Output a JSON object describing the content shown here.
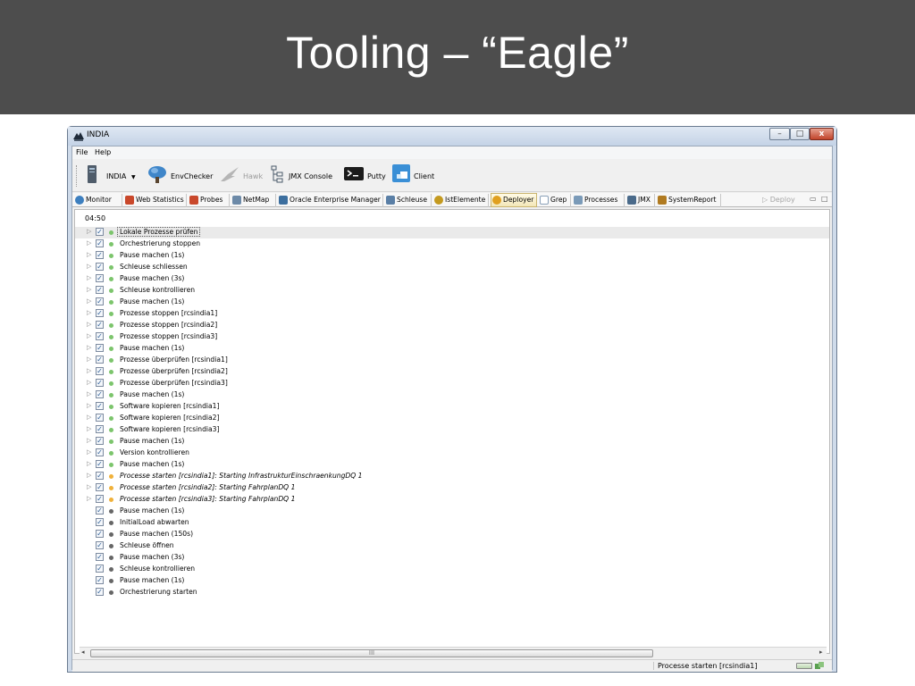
{
  "slide": {
    "title": "Tooling – “Eagle”"
  },
  "window": {
    "title": "INDIA",
    "controls": {
      "minimize": "–",
      "maximize": "□",
      "close": "x"
    }
  },
  "menu": {
    "file": "File",
    "help": "Help"
  },
  "toolbar": {
    "environment": "INDIA",
    "env_dropdown_icon": "▼",
    "envchecker": "EnvChecker",
    "hawk": "Hawk",
    "jmx_console": "JMX Console",
    "putty": "Putty",
    "client": "Client"
  },
  "tabs": [
    {
      "label": "Monitor",
      "icon": "globe-icon",
      "color": "#3d7fbf"
    },
    {
      "label": "Web Statistics",
      "icon": "chart-icon",
      "color": "#c9482b"
    },
    {
      "label": "Probes",
      "icon": "probe-icon",
      "color": "#c9482b"
    },
    {
      "label": "NetMap",
      "icon": "netmap-icon",
      "color": "#6d8aa8"
    },
    {
      "label": "Oracle Enterprise Manager",
      "icon": "oracle-icon",
      "color": "#3c6e9e"
    },
    {
      "label": "Schleuse",
      "icon": "lock-icon",
      "color": "#5a7fa6"
    },
    {
      "label": "IstElemente",
      "icon": "clock-icon",
      "color": "#c49a20"
    },
    {
      "label": "Deployer",
      "icon": "gear-icon",
      "color": "#e0a020"
    },
    {
      "label": "Grep",
      "icon": "document-icon",
      "color": "#8aa0b8"
    },
    {
      "label": "Processes",
      "icon": "process-icon",
      "color": "#7a9ab8"
    },
    {
      "label": "JMX",
      "icon": "server-icon",
      "color": "#4a6a8a"
    },
    {
      "label": "SystemReport",
      "icon": "report-icon",
      "color": "#b07a20"
    }
  ],
  "active_tab": "Deployer",
  "deploy_action": "▷ Deploy",
  "view_controls": {
    "minimize": "▭",
    "maximize": "□"
  },
  "elapsed_time": "04:50",
  "colors": {
    "dot_done": "#7cc56c",
    "dot_running": "#f0b13a",
    "dot_pending": "#666666"
  },
  "rows": [
    {
      "text": "Lokale Prozesse prüfen",
      "expandable": true,
      "checked": "✓",
      "state": "done",
      "italic": false,
      "selected": true
    },
    {
      "text": "Orchestrierung stoppen",
      "expandable": true,
      "checked": "✓",
      "state": "done",
      "italic": false
    },
    {
      "text": "Pause machen (1s)",
      "expandable": true,
      "checked": "✓",
      "state": "done",
      "italic": false
    },
    {
      "text": "Schleuse schliessen",
      "expandable": true,
      "checked": "✓",
      "state": "done",
      "italic": false
    },
    {
      "text": "Pause machen (3s)",
      "expandable": true,
      "checked": "✓",
      "state": "done",
      "italic": false
    },
    {
      "text": "Schleuse kontrollieren",
      "expandable": true,
      "checked": "✓",
      "state": "done",
      "italic": false
    },
    {
      "text": "Pause machen (1s)",
      "expandable": true,
      "checked": "✓",
      "state": "done",
      "italic": false
    },
    {
      "text": "Prozesse stoppen [rcsindia1]",
      "expandable": true,
      "checked": "✓",
      "state": "done",
      "italic": false
    },
    {
      "text": "Prozesse stoppen [rcsindia2]",
      "expandable": true,
      "checked": "✓",
      "state": "done",
      "italic": false
    },
    {
      "text": "Prozesse stoppen [rcsindia3]",
      "expandable": true,
      "checked": "✓",
      "state": "done",
      "italic": false
    },
    {
      "text": "Pause machen (1s)",
      "expandable": true,
      "checked": "✓",
      "state": "done",
      "italic": false
    },
    {
      "text": "Prozesse überprüfen [rcsindia1]",
      "expandable": true,
      "checked": "✓",
      "state": "done",
      "italic": false
    },
    {
      "text": "Prozesse überprüfen [rcsindia2]",
      "expandable": true,
      "checked": "✓",
      "state": "done",
      "italic": false
    },
    {
      "text": "Prozesse überprüfen [rcsindia3]",
      "expandable": true,
      "checked": "✓",
      "state": "done",
      "italic": false
    },
    {
      "text": "Pause machen (1s)",
      "expandable": true,
      "checked": "✓",
      "state": "done",
      "italic": false
    },
    {
      "text": "Software kopieren [rcsindia1]",
      "expandable": true,
      "checked": "✓",
      "state": "done",
      "italic": false
    },
    {
      "text": "Software kopieren [rcsindia2]",
      "expandable": true,
      "checked": "✓",
      "state": "done",
      "italic": false
    },
    {
      "text": "Software kopieren [rcsindia3]",
      "expandable": true,
      "checked": "✓",
      "state": "done",
      "italic": false
    },
    {
      "text": "Pause machen (1s)",
      "expandable": true,
      "checked": "✓",
      "state": "done",
      "italic": false
    },
    {
      "text": "Version kontrollieren",
      "expandable": true,
      "checked": "✓",
      "state": "done",
      "italic": false
    },
    {
      "text": "Pause machen (1s)",
      "expandable": true,
      "checked": "✓",
      "state": "done",
      "italic": false
    },
    {
      "text": "Processe starten [rcsindia1]: Starting InfrastrukturEinschraenkungDQ 1",
      "expandable": true,
      "checked": "✓",
      "state": "running",
      "italic": true
    },
    {
      "text": "Processe starten [rcsindia2]: Starting FahrplanDQ 1",
      "expandable": true,
      "checked": "✓",
      "state": "running",
      "italic": true
    },
    {
      "text": "Processe starten [rcsindia3]: Starting FahrplanDQ 1",
      "expandable": true,
      "checked": "✓",
      "state": "running",
      "italic": true
    },
    {
      "text": "Pause machen (1s)",
      "expandable": false,
      "checked": "✓",
      "state": "pending",
      "italic": false
    },
    {
      "text": "InitialLoad abwarten",
      "expandable": false,
      "checked": "✓",
      "state": "pending",
      "italic": false
    },
    {
      "text": "Pause machen (150s)",
      "expandable": false,
      "checked": "✓",
      "state": "pending",
      "italic": false
    },
    {
      "text": "Schleuse öffnen",
      "expandable": false,
      "checked": "✓",
      "state": "pending",
      "italic": false
    },
    {
      "text": "Pause machen (3s)",
      "expandable": false,
      "checked": "✓",
      "state": "pending",
      "italic": false
    },
    {
      "text": "Schleuse kontrollieren",
      "expandable": false,
      "checked": "✓",
      "state": "pending",
      "italic": false
    },
    {
      "text": "Pause machen (1s)",
      "expandable": false,
      "checked": "✓",
      "state": "pending",
      "italic": false
    },
    {
      "text": "Orchestrierung starten",
      "expandable": false,
      "checked": "✓",
      "state": "pending",
      "italic": false
    }
  ],
  "scrollbar": {
    "left_arrow": "◂",
    "right_arrow": "▸",
    "grip": "III"
  },
  "status": {
    "text": "Processe starten [rcsindia1]"
  }
}
